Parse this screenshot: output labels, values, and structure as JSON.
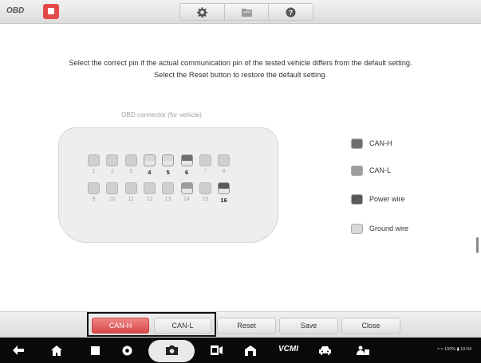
{
  "app": {
    "logo": "OBD"
  },
  "toolbar": {
    "home_icon": "home-square-icon",
    "tools": [
      {
        "name": "settings",
        "icon": "gear-icon"
      },
      {
        "name": "files",
        "icon": "folder-icon"
      },
      {
        "name": "help",
        "icon": "help-icon"
      }
    ]
  },
  "instructions": {
    "line1": "Select the correct pin if the actual communication pin of the tested vehicle differs from the default setting.",
    "line2": "Select the Reset button to restore the default setting."
  },
  "connector": {
    "title": "OBD connector (for vehicle)",
    "pins": [
      {
        "num": "1",
        "role": "default"
      },
      {
        "num": "2",
        "role": "default"
      },
      {
        "num": "3",
        "role": "default"
      },
      {
        "num": "4",
        "role": "ground"
      },
      {
        "num": "5",
        "role": "ground"
      },
      {
        "num": "6",
        "role": "can-h"
      },
      {
        "num": "7",
        "role": "default"
      },
      {
        "num": "8",
        "role": "default"
      },
      {
        "num": "9",
        "role": "default"
      },
      {
        "num": "10",
        "role": "default"
      },
      {
        "num": "11",
        "role": "default"
      },
      {
        "num": "12",
        "role": "default"
      },
      {
        "num": "13",
        "role": "default"
      },
      {
        "num": "14",
        "role": "can-l"
      },
      {
        "num": "15",
        "role": "default"
      },
      {
        "num": "16",
        "role": "power"
      }
    ]
  },
  "legend": [
    {
      "label": "CAN-H",
      "role": "can-h"
    },
    {
      "label": "CAN-L",
      "role": "can-l"
    },
    {
      "label": "Power wire",
      "role": "power"
    },
    {
      "label": "Ground wire",
      "role": "ground"
    }
  ],
  "colors": {
    "can-h": "#6e6e6e",
    "can-l": "#9d9d9d",
    "power": "#5a5a5a",
    "ground": "#d8d8d8",
    "default": "#cfcfcf",
    "active_button": "#d94848"
  },
  "buttons": {
    "can_h": "CAN-H",
    "can_l": "CAN-L",
    "reset": "Reset",
    "save": "Save",
    "close": "Close"
  },
  "navbar": {
    "vcmi": "VCMI",
    "status": "≈ ≈ 100% ▮ 10:04"
  }
}
